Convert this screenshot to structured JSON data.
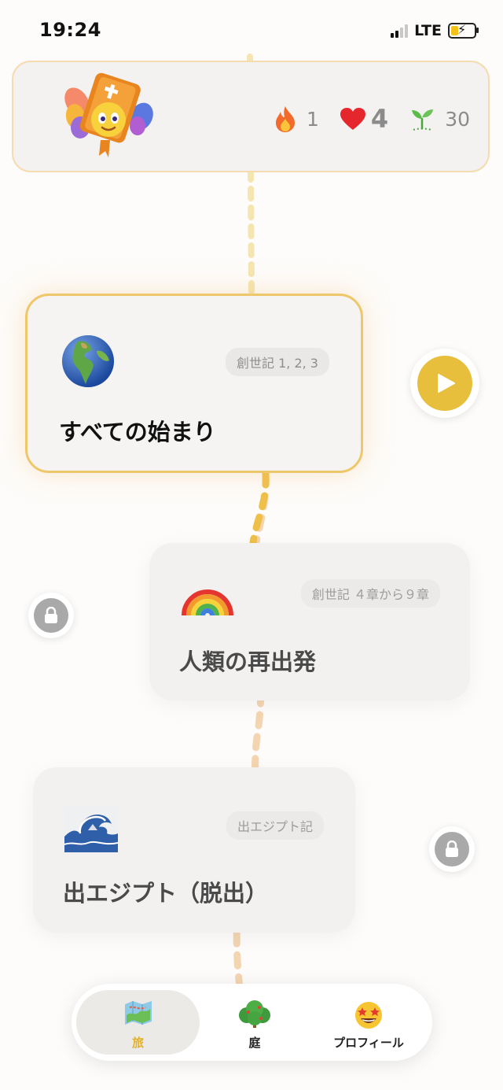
{
  "status_bar": {
    "time": "19:24",
    "network": "LTE"
  },
  "header": {
    "mascot_icon": "winged-bible-mascot-icon",
    "streak": {
      "icon": "fire-icon",
      "value": "1"
    },
    "hearts": {
      "icon": "heart-icon",
      "value": "4"
    },
    "sprouts": {
      "icon": "sprout-icon",
      "value": "30"
    }
  },
  "lessons": [
    {
      "title": "すべての始まり",
      "chip": "創世記 1, 2, 3",
      "icon": "globe-icon",
      "state": "current"
    },
    {
      "title": "人類の再出発",
      "chip": "創世記 ４章から９章",
      "icon": "rainbow-icon",
      "state": "locked"
    },
    {
      "title": "出エジプト（脱出）",
      "chip": "出エジプト記",
      "icon": "wave-icon",
      "state": "locked"
    }
  ],
  "nodes": {
    "play_icon": "play-icon",
    "lock_icon": "lock-icon"
  },
  "tabs": [
    {
      "label": "旅",
      "icon": "map-icon",
      "active": true
    },
    {
      "label": "庭",
      "icon": "bush-icon",
      "active": false
    },
    {
      "label": "プロフィール",
      "icon": "star-struck-face-icon",
      "active": false
    }
  ],
  "colors": {
    "accent_yellow": "#e8bf3c",
    "active_tab_label": "#e3b12c",
    "card_border_active": "#eec76a",
    "lock_gray": "#a9a9a9"
  }
}
